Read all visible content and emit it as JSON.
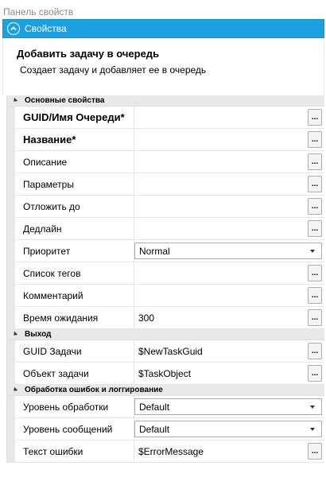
{
  "panel": {
    "title": "Панель свойств"
  },
  "section": {
    "label": "Свойства",
    "icon": "collapse-up-circle-icon",
    "accent": "#1ba1e2"
  },
  "activity": {
    "title": "Добавить задачу в очередь",
    "description": "Создает задачу и добавляет ее в очередь"
  },
  "categories": [
    {
      "label": "Основные свойства",
      "rows": [
        {
          "name": "GUID/Имя Очереди*",
          "value": "",
          "kind": "button",
          "bold": true
        },
        {
          "name": "Название*",
          "value": "",
          "kind": "button",
          "bold": true
        },
        {
          "name": "Описание",
          "value": "",
          "kind": "button"
        },
        {
          "name": "Параметры",
          "value": "",
          "kind": "button"
        },
        {
          "name": "Отложить до",
          "value": "",
          "kind": "button"
        },
        {
          "name": "Дедлайн",
          "value": "",
          "kind": "button"
        },
        {
          "name": "Приоритет",
          "value": "Normal",
          "kind": "combo"
        },
        {
          "name": "Список тегов",
          "value": "",
          "kind": "button"
        },
        {
          "name": "Комментарий",
          "value": "",
          "kind": "button"
        },
        {
          "name": "Время ожидания",
          "value": "300",
          "kind": "button"
        }
      ]
    },
    {
      "label": "Выход",
      "rows": [
        {
          "name": "GUID Задачи",
          "value": "$NewTaskGuid",
          "kind": "button"
        },
        {
          "name": "Объект задачи",
          "value": "$TaskObject",
          "kind": "button"
        }
      ]
    },
    {
      "label": "Обработка ошибок и логгирование",
      "rows": [
        {
          "name": "Уровень обработки",
          "value": "Default",
          "kind": "combo"
        },
        {
          "name": "Уровень сообщений",
          "value": "Default",
          "kind": "combo"
        },
        {
          "name": "Текст ошибки",
          "value": "$ErrorMessage",
          "kind": "button"
        }
      ]
    }
  ],
  "button_label": "..."
}
